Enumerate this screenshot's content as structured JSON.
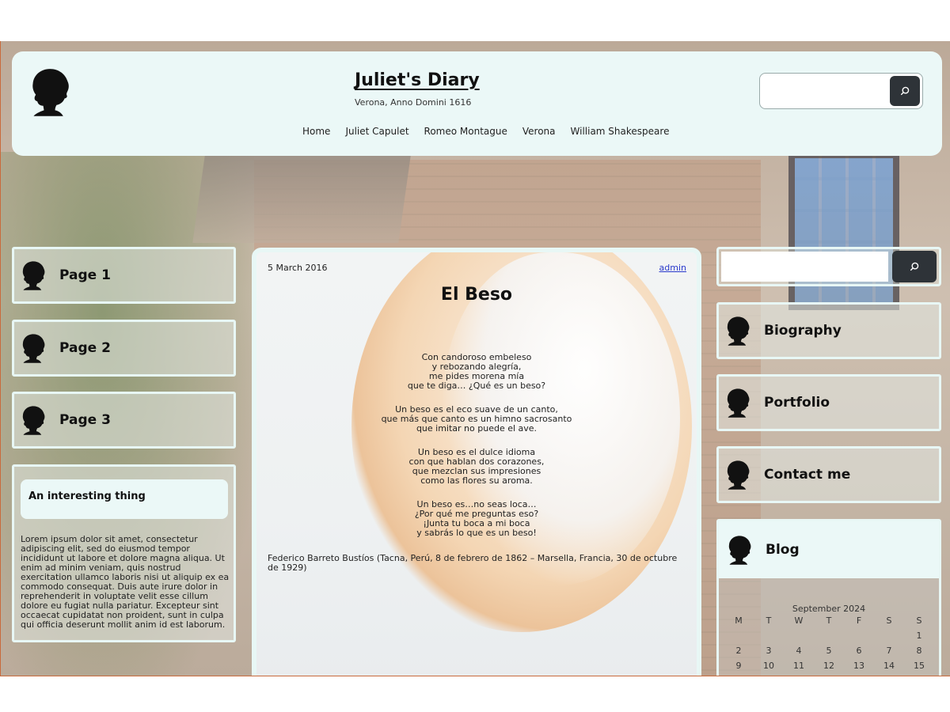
{
  "header": {
    "site_title": "Juliet's Diary",
    "tagline": "Verona, Anno Domini 1616",
    "nav": [
      "Home",
      "Juliet Capulet",
      "Romeo Montague",
      "Verona",
      "William Shakespeare"
    ],
    "search_placeholder": ""
  },
  "left_sidebar": {
    "pages": [
      "Page 1",
      "Page 2",
      "Page 3"
    ],
    "widget": {
      "title": "An interesting thing",
      "text": "Lorem ipsum dolor sit amet, consectetur adipiscing elit, sed do eiusmod tempor incididunt ut labore et dolore magna aliqua. Ut enim ad minim veniam, quis nostrud exercitation ullamco laboris nisi ut aliquip ex ea commodo consequat. Duis aute irure dolor in reprehenderit in voluptate velit esse cillum dolore eu fugiat nulla pariatur. Excepteur sint occaecat cupidatat non proident, sunt in culpa qui officia deserunt mollit anim id est laborum."
    }
  },
  "article": {
    "date": "5 March 2016",
    "author": "admin",
    "title": "El Beso",
    "stanzas": [
      [
        "Con candoroso embeleso",
        "y rebozando alegría,",
        "me pides morena mía",
        "que te diga… ¿Qué es un beso?"
      ],
      [
        "Un beso es el eco suave de un canto,",
        "que más que canto es un himno sacrosanto",
        "que imitar no puede el ave."
      ],
      [
        "Un beso es el dulce idioma",
        "con que hablan dos corazones,",
        "que mezclan sus impresiones",
        "como las flores su aroma."
      ],
      [
        "Un beso es…no seas loca…",
        "¿Por qué me preguntas eso?",
        "¡Junta tu boca a mi boca",
        "y sabrás lo que es un beso!"
      ]
    ],
    "attribution": "Federico Barreto Bustíos (Tacna, Perú, 8 de febrero de 1862 – Marsella, Francia, 30 de octubre de 1929)"
  },
  "right_sidebar": {
    "search_placeholder": "",
    "links": [
      "Biography",
      "Portfolio",
      "Contact me"
    ],
    "blog": {
      "title": "Blog",
      "calendar": {
        "caption": "September 2024",
        "weekdays": [
          "M",
          "T",
          "W",
          "T",
          "F",
          "S",
          "S"
        ],
        "rows": [
          [
            "",
            "",
            "",
            "",
            "",
            "",
            "1"
          ],
          [
            "2",
            "3",
            "4",
            "5",
            "6",
            "7",
            "8"
          ],
          [
            "9",
            "10",
            "11",
            "12",
            "13",
            "14",
            "15"
          ]
        ]
      }
    }
  },
  "icons": {
    "logo": "woman-silhouette-icon",
    "search": "search-icon"
  },
  "colors": {
    "panel": "#ebf8f7",
    "button": "#2e3338",
    "link": "#2a3acc"
  }
}
